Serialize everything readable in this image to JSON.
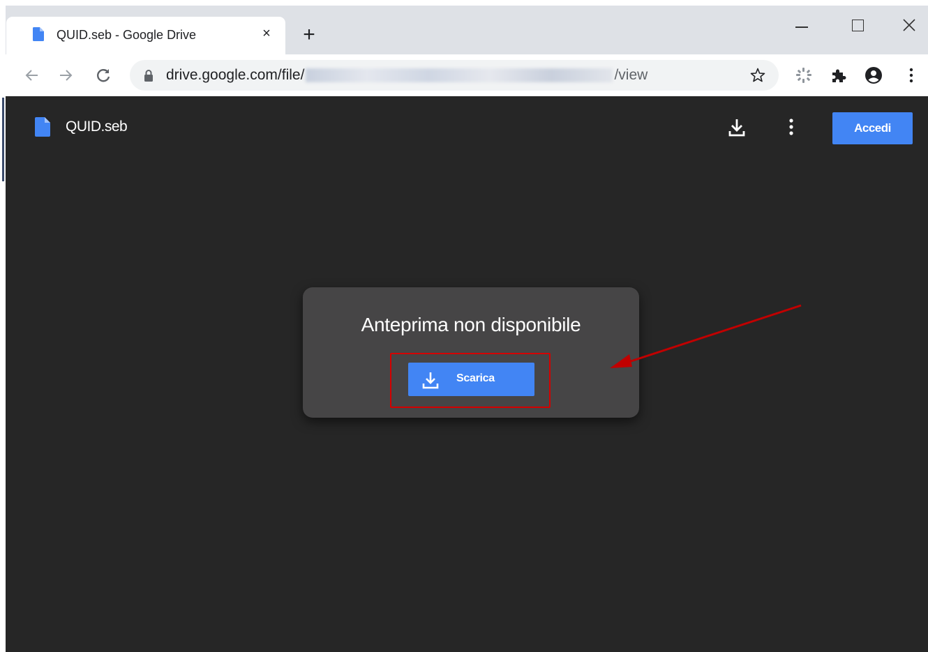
{
  "browser": {
    "tab": {
      "title": "QUID.seb - Google Drive",
      "close_glyph": "×",
      "favicon": "google-docs-file-icon"
    },
    "new_tab_glyph": "+",
    "address": {
      "url_prefix": "drive.google.com/file/",
      "url_suffix": "/view"
    },
    "icons": [
      "back-arrow-icon",
      "forward-arrow-icon",
      "reload-icon",
      "lock-icon",
      "star-icon",
      "extension-icon",
      "puzzle-icon",
      "profile-icon",
      "kebab-menu-icon"
    ]
  },
  "viewer": {
    "file_name": "QUID.seb",
    "signin_label": "Accedi",
    "preview_message": "Anteprima non disponibile",
    "download_label": "Scarica",
    "accent_color": "#4285f4",
    "background_color": "#262626",
    "card_color": "#464546",
    "annotation_color": "#c00000"
  }
}
